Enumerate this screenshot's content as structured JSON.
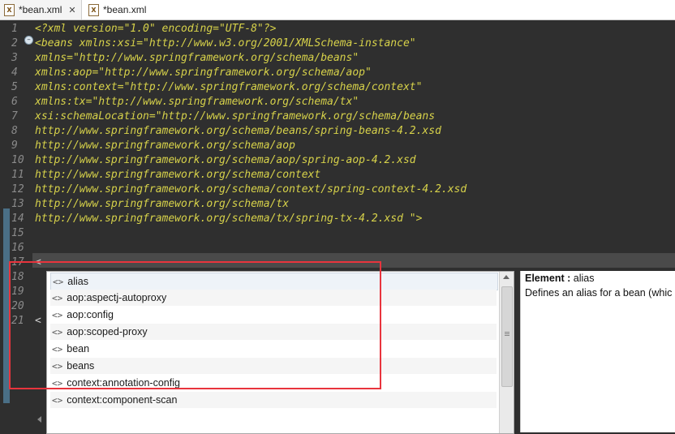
{
  "tabs": [
    {
      "label": "*bean.xml",
      "active": true
    },
    {
      "label": "*bean.xml",
      "active": false
    }
  ],
  "editor": {
    "lines": [
      {
        "n": "1",
        "text": "<?xml version=\"1.0\" encoding=\"UTF-8\"?>"
      },
      {
        "n": "2",
        "text": "<beans xmlns:xsi=\"http://www.w3.org/2001/XMLSchema-instance\""
      },
      {
        "n": "3",
        "text": "xmlns=\"http://www.springframework.org/schema/beans\""
      },
      {
        "n": "4",
        "text": "xmlns:aop=\"http://www.springframework.org/schema/aop\""
      },
      {
        "n": "5",
        "text": "xmlns:context=\"http://www.springframework.org/schema/context\""
      },
      {
        "n": "6",
        "text": "xmlns:tx=\"http://www.springframework.org/schema/tx\""
      },
      {
        "n": "7",
        "text": "xsi:schemaLocation=\"http://www.springframework.org/schema/beans"
      },
      {
        "n": "8",
        "text": "http://www.springframework.org/schema/beans/spring-beans-4.2.xsd"
      },
      {
        "n": "9",
        "text": "http://www.springframework.org/schema/aop"
      },
      {
        "n": "10",
        "text": "http://www.springframework.org/schema/aop/spring-aop-4.2.xsd"
      },
      {
        "n": "11",
        "text": "http://www.springframework.org/schema/context"
      },
      {
        "n": "12",
        "text": "http://www.springframework.org/schema/context/spring-context-4.2.xsd"
      },
      {
        "n": "13",
        "text": "http://www.springframework.org/schema/tx"
      },
      {
        "n": "14",
        "text": "http://www.springframework.org/schema/tx/spring-tx-4.2.xsd \">"
      },
      {
        "n": "15",
        "text": ""
      },
      {
        "n": "16",
        "text": ""
      },
      {
        "n": "17",
        "text": "<"
      },
      {
        "n": "18",
        "text": ""
      },
      {
        "n": "19",
        "text": ""
      },
      {
        "n": "20",
        "text": ""
      },
      {
        "n": "21",
        "text": "<"
      }
    ],
    "fold_marker": "−"
  },
  "autocomplete": {
    "icon_glyph": "<>",
    "items": [
      "alias",
      "aop:aspectj-autoproxy",
      "aop:config",
      "aop:scoped-proxy",
      "bean",
      "beans",
      "context:annotation-config",
      "context:component-scan"
    ]
  },
  "info": {
    "title_label": "Element :",
    "title_value": "alias",
    "description": "Defines an alias for a bean (whic"
  }
}
